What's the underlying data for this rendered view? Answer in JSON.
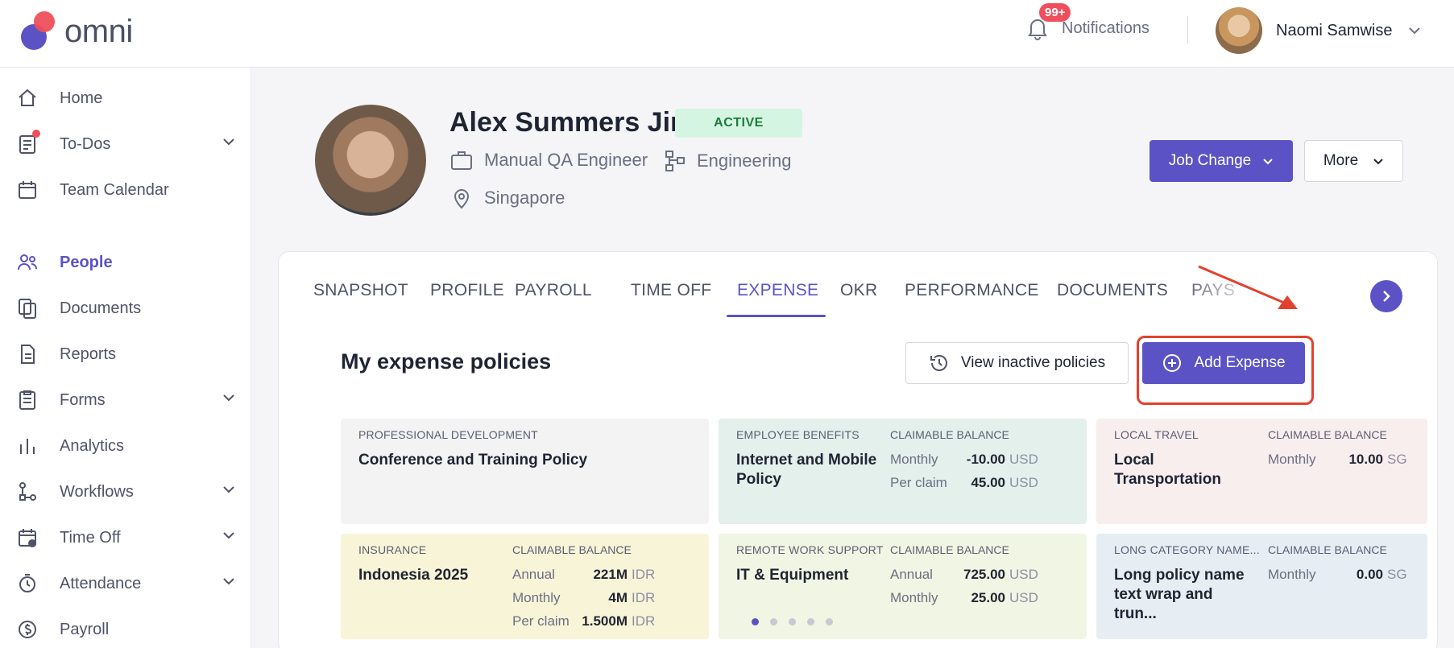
{
  "brand": {
    "name": "omni"
  },
  "topbar": {
    "notifications_label": "Notifications",
    "notifications_badge": "99+",
    "user_name": "Naomi Samwise"
  },
  "sidebar": {
    "items": [
      {
        "label": "Home",
        "icon": "home-icon",
        "active": false,
        "expandable": false
      },
      {
        "label": "To-Dos",
        "icon": "todo-icon",
        "active": false,
        "expandable": true
      },
      {
        "label": "Team Calendar",
        "icon": "calendar-icon",
        "active": false,
        "expandable": false
      },
      {
        "label": "People",
        "icon": "people-icon",
        "active": true,
        "expandable": false
      },
      {
        "label": "Documents",
        "icon": "documents-icon",
        "active": false,
        "expandable": false
      },
      {
        "label": "Reports",
        "icon": "reports-icon",
        "active": false,
        "expandable": false
      },
      {
        "label": "Forms",
        "icon": "forms-icon",
        "active": false,
        "expandable": true
      },
      {
        "label": "Analytics",
        "icon": "analytics-icon",
        "active": false,
        "expandable": false
      },
      {
        "label": "Workflows",
        "icon": "workflows-icon",
        "active": false,
        "expandable": true
      },
      {
        "label": "Time Off",
        "icon": "time-off-icon",
        "active": false,
        "expandable": true
      },
      {
        "label": "Attendance",
        "icon": "attendance-icon",
        "active": false,
        "expandable": true
      },
      {
        "label": "Payroll",
        "icon": "payroll-icon",
        "active": false,
        "expandable": false
      }
    ]
  },
  "profile": {
    "name": "Alex Summers Jin",
    "status": "ACTIVE",
    "job_title": "Manual QA Engineer",
    "department": "Engineering",
    "location": "Singapore",
    "job_change_label": "Job Change",
    "more_label": "More"
  },
  "tabs": [
    {
      "label": "SNAPSHOT",
      "active": false
    },
    {
      "label": "PROFILE",
      "active": false
    },
    {
      "label": "PAYROLL",
      "active": false
    },
    {
      "label": "TIME OFF",
      "active": false
    },
    {
      "label": "EXPENSE",
      "active": true
    },
    {
      "label": "OKR",
      "active": false
    },
    {
      "label": "PERFORMANCE",
      "active": false
    },
    {
      "label": "DOCUMENTS",
      "active": false
    },
    {
      "label": "PAYS",
      "active": false
    }
  ],
  "expense": {
    "section_title": "My expense policies",
    "view_inactive_label": "View inactive policies",
    "add_expense_label": "Add Expense",
    "claimable_header": "CLAIMABLE BALANCE",
    "policies": [
      {
        "category": "PROFESSIONAL DEVELOPMENT",
        "name": "Conference and Training Policy",
        "color": "#f3f3f4",
        "balances": []
      },
      {
        "category": "EMPLOYEE BENEFITS",
        "name": "Internet and Mobile Policy",
        "color": "#e3f0ec",
        "balances": [
          {
            "period": "Monthly",
            "amount": "-10.00",
            "currency": "USD"
          },
          {
            "period": "Per claim",
            "amount": "45.00",
            "currency": "USD"
          }
        ]
      },
      {
        "category": "LOCAL TRAVEL",
        "name": "Local Transportation",
        "color": "#f8eeee",
        "balances": [
          {
            "period": "Monthly",
            "amount": "10.00",
            "currency": "SG"
          }
        ]
      },
      {
        "category": "INSURANCE",
        "name": "Indonesia 2025",
        "color": "#f8f4d8",
        "balances": [
          {
            "period": "Annual",
            "amount": "221M",
            "currency": "IDR"
          },
          {
            "period": "Monthly",
            "amount": "4M",
            "currency": "IDR"
          },
          {
            "period": "Per claim",
            "amount": "1.500M",
            "currency": "IDR"
          }
        ]
      },
      {
        "category": "REMOTE WORK SUPPORT",
        "name": "IT & Equipment",
        "color": "#f1f5e3",
        "balances": [
          {
            "period": "Annual",
            "amount": "725.00",
            "currency": "USD"
          },
          {
            "period": "Monthly",
            "amount": "25.00",
            "currency": "USD"
          }
        ]
      },
      {
        "category": "LONG CATEGORY NAME...",
        "name": "Long policy name text wrap and trun...",
        "color": "#e6eef3",
        "balances": [
          {
            "period": "Monthly",
            "amount": "0.00",
            "currency": "SG"
          }
        ]
      }
    ],
    "pagination": {
      "pages": 5,
      "current": 1
    }
  },
  "colors": {
    "brand": "#5b53c5",
    "accent": "#ef4f5c",
    "highlight": "#e2412f"
  }
}
